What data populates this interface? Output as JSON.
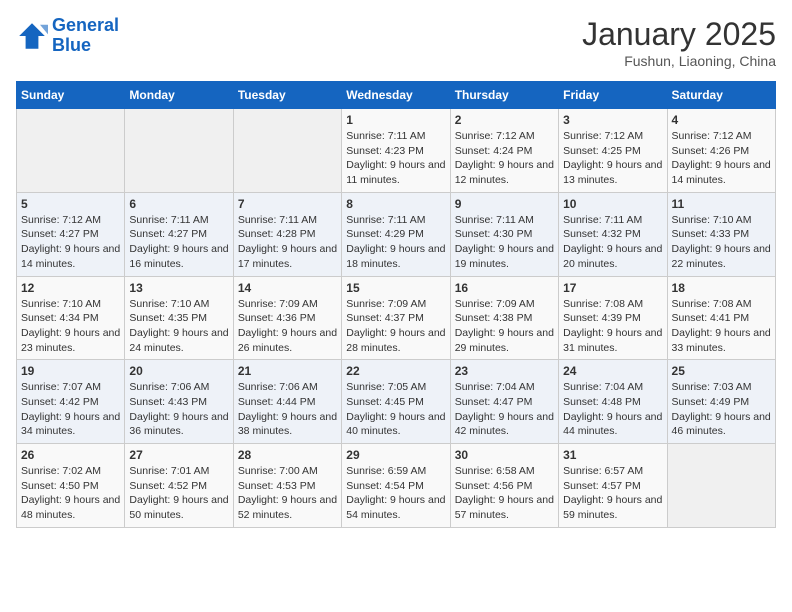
{
  "logo": {
    "line1": "General",
    "line2": "Blue"
  },
  "title": "January 2025",
  "subtitle": "Fushun, Liaoning, China",
  "days_of_week": [
    "Sunday",
    "Monday",
    "Tuesday",
    "Wednesday",
    "Thursday",
    "Friday",
    "Saturday"
  ],
  "weeks": [
    [
      {
        "day": "",
        "info": ""
      },
      {
        "day": "",
        "info": ""
      },
      {
        "day": "",
        "info": ""
      },
      {
        "day": "1",
        "info": "Sunrise: 7:11 AM\nSunset: 4:23 PM\nDaylight: 9 hours and 11 minutes."
      },
      {
        "day": "2",
        "info": "Sunrise: 7:12 AM\nSunset: 4:24 PM\nDaylight: 9 hours and 12 minutes."
      },
      {
        "day": "3",
        "info": "Sunrise: 7:12 AM\nSunset: 4:25 PM\nDaylight: 9 hours and 13 minutes."
      },
      {
        "day": "4",
        "info": "Sunrise: 7:12 AM\nSunset: 4:26 PM\nDaylight: 9 hours and 14 minutes."
      }
    ],
    [
      {
        "day": "5",
        "info": "Sunrise: 7:12 AM\nSunset: 4:27 PM\nDaylight: 9 hours and 14 minutes."
      },
      {
        "day": "6",
        "info": "Sunrise: 7:11 AM\nSunset: 4:27 PM\nDaylight: 9 hours and 16 minutes."
      },
      {
        "day": "7",
        "info": "Sunrise: 7:11 AM\nSunset: 4:28 PM\nDaylight: 9 hours and 17 minutes."
      },
      {
        "day": "8",
        "info": "Sunrise: 7:11 AM\nSunset: 4:29 PM\nDaylight: 9 hours and 18 minutes."
      },
      {
        "day": "9",
        "info": "Sunrise: 7:11 AM\nSunset: 4:30 PM\nDaylight: 9 hours and 19 minutes."
      },
      {
        "day": "10",
        "info": "Sunrise: 7:11 AM\nSunset: 4:32 PM\nDaylight: 9 hours and 20 minutes."
      },
      {
        "day": "11",
        "info": "Sunrise: 7:10 AM\nSunset: 4:33 PM\nDaylight: 9 hours and 22 minutes."
      }
    ],
    [
      {
        "day": "12",
        "info": "Sunrise: 7:10 AM\nSunset: 4:34 PM\nDaylight: 9 hours and 23 minutes."
      },
      {
        "day": "13",
        "info": "Sunrise: 7:10 AM\nSunset: 4:35 PM\nDaylight: 9 hours and 24 minutes."
      },
      {
        "day": "14",
        "info": "Sunrise: 7:09 AM\nSunset: 4:36 PM\nDaylight: 9 hours and 26 minutes."
      },
      {
        "day": "15",
        "info": "Sunrise: 7:09 AM\nSunset: 4:37 PM\nDaylight: 9 hours and 28 minutes."
      },
      {
        "day": "16",
        "info": "Sunrise: 7:09 AM\nSunset: 4:38 PM\nDaylight: 9 hours and 29 minutes."
      },
      {
        "day": "17",
        "info": "Sunrise: 7:08 AM\nSunset: 4:39 PM\nDaylight: 9 hours and 31 minutes."
      },
      {
        "day": "18",
        "info": "Sunrise: 7:08 AM\nSunset: 4:41 PM\nDaylight: 9 hours and 33 minutes."
      }
    ],
    [
      {
        "day": "19",
        "info": "Sunrise: 7:07 AM\nSunset: 4:42 PM\nDaylight: 9 hours and 34 minutes."
      },
      {
        "day": "20",
        "info": "Sunrise: 7:06 AM\nSunset: 4:43 PM\nDaylight: 9 hours and 36 minutes."
      },
      {
        "day": "21",
        "info": "Sunrise: 7:06 AM\nSunset: 4:44 PM\nDaylight: 9 hours and 38 minutes."
      },
      {
        "day": "22",
        "info": "Sunrise: 7:05 AM\nSunset: 4:45 PM\nDaylight: 9 hours and 40 minutes."
      },
      {
        "day": "23",
        "info": "Sunrise: 7:04 AM\nSunset: 4:47 PM\nDaylight: 9 hours and 42 minutes."
      },
      {
        "day": "24",
        "info": "Sunrise: 7:04 AM\nSunset: 4:48 PM\nDaylight: 9 hours and 44 minutes."
      },
      {
        "day": "25",
        "info": "Sunrise: 7:03 AM\nSunset: 4:49 PM\nDaylight: 9 hours and 46 minutes."
      }
    ],
    [
      {
        "day": "26",
        "info": "Sunrise: 7:02 AM\nSunset: 4:50 PM\nDaylight: 9 hours and 48 minutes."
      },
      {
        "day": "27",
        "info": "Sunrise: 7:01 AM\nSunset: 4:52 PM\nDaylight: 9 hours and 50 minutes."
      },
      {
        "day": "28",
        "info": "Sunrise: 7:00 AM\nSunset: 4:53 PM\nDaylight: 9 hours and 52 minutes."
      },
      {
        "day": "29",
        "info": "Sunrise: 6:59 AM\nSunset: 4:54 PM\nDaylight: 9 hours and 54 minutes."
      },
      {
        "day": "30",
        "info": "Sunrise: 6:58 AM\nSunset: 4:56 PM\nDaylight: 9 hours and 57 minutes."
      },
      {
        "day": "31",
        "info": "Sunrise: 6:57 AM\nSunset: 4:57 PM\nDaylight: 9 hours and 59 minutes."
      },
      {
        "day": "",
        "info": ""
      }
    ]
  ]
}
